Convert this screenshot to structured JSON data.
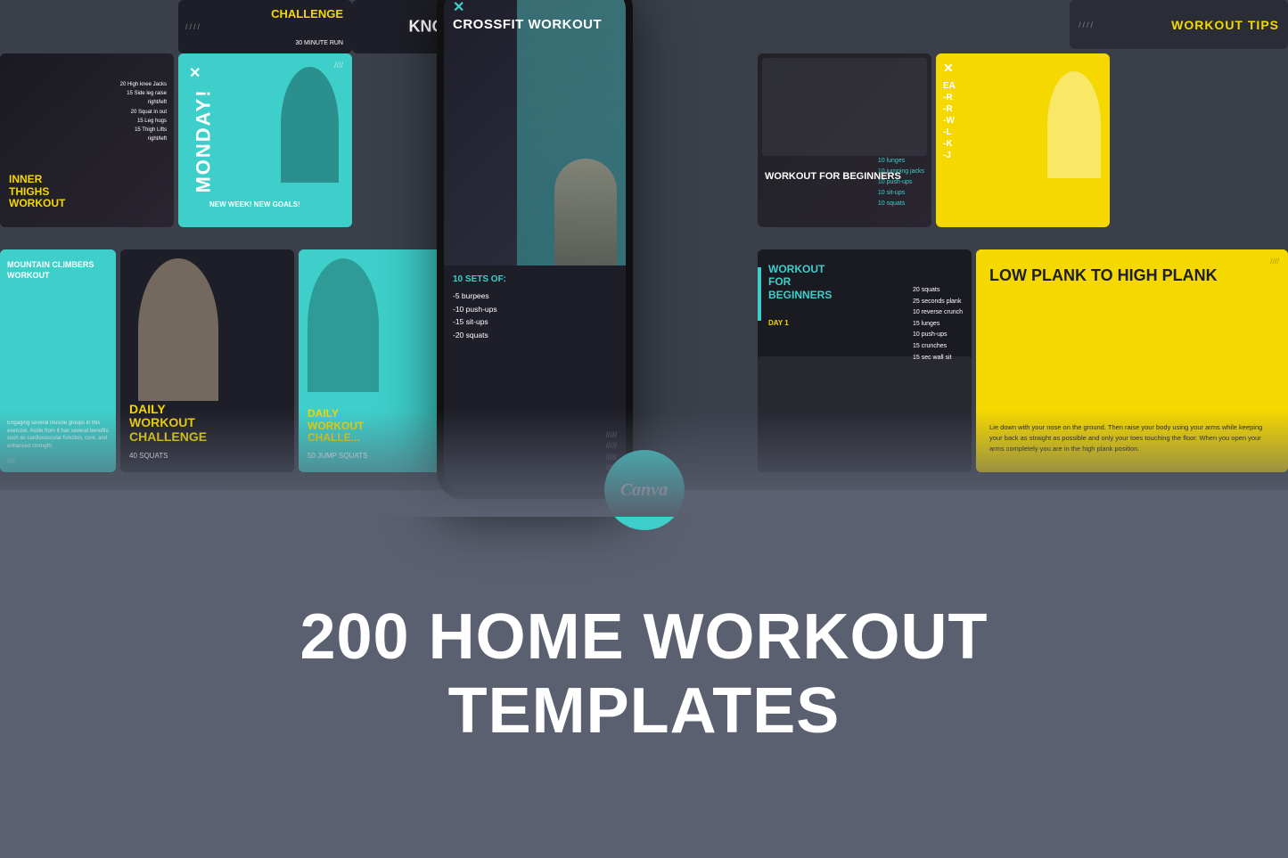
{
  "page": {
    "title": "200 Home Workout Templates",
    "subtitle": "Canva",
    "accent_color": "#3ecfca",
    "yellow_color": "#f5d800",
    "dark_color": "#1e1e28",
    "bg_color": "#5a6070"
  },
  "cards": {
    "workout_tips": "WORKOUT TIPS",
    "inner_thighs": "INNER THIGHS WORKOUT",
    "inner_thighs_exercises": "20 High knee Jacks\n15 Side leg raise right/left\n20 Squat in out\n15 Leg hugs\n15 Thigh Lifts right/left",
    "monday": "MONDAY!",
    "monday_sub": "NEW WEEK! NEW GOALS!",
    "crossfit_title": "CROSSFIT WORKOUT",
    "crossfit_sets": "10 SETS OF:",
    "crossfit_exercises": "-5 burpees\n-10 push-ups\n-15 sit-ups\n-20 squats",
    "beginners_1_title": "WORKOUT FOR BEGINNERS",
    "beginners_1_exercises": "10 lunges\n10 jumping jacks\n10 push-ups\n10 sit-ups\n10 squats",
    "mountain_title": "MOUNTAIN CLIMBERS WORKOUT",
    "mountain_desc": "Engaging several muscle groups in this exercise. Aside from it has several benefits such as cardiovascular function, core, and enhanced strength.",
    "daily_1_title": "DAILY WORKOUT CHALLENGE",
    "daily_1_sub": "40 SQUATS",
    "daily_2_title": "DAILY WORKOUT CHALLENGE",
    "daily_2_sub": "50 JUMP SQUATS",
    "beginners_day1_title": "WORKOUT FOR BEGINNERS",
    "beginners_day1": "DAY 1",
    "beginners_day1_exercises": "20 squats\n25 seconds plank\n10 reverse crunch\n15 lunges\n10 push-ups\n15 crunches\n15 sec wall sit",
    "low_plank_title": "LOW PLANK TO HIGH PLANK",
    "low_plank_desc": "Lie down with your nose on the ground. Then raise your body using your arms while keeping your back as straight as possible and only your toes touching the floor. When you open your arms completely you are in the high plank position.",
    "challenge_top": "CHALLENGE",
    "challenge_sub": "30 MINUTE RUN",
    "know": "KNOW?",
    "main_title_line1": "200 HOME WORKOUT",
    "main_title_line2": "TEMPLATES"
  }
}
